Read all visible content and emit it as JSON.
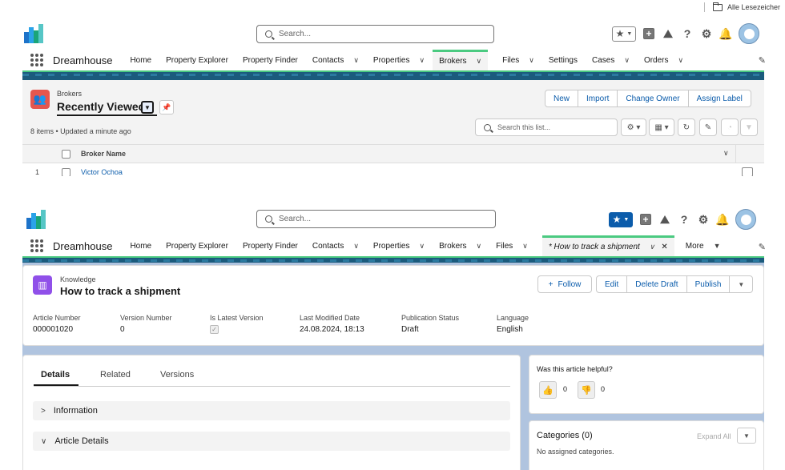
{
  "bookmarks": {
    "label": "Alle Lesezeicher"
  },
  "top": {
    "search_placeholder": "Search...",
    "app_name": "Dreamhouse",
    "nav": [
      "Home",
      "Property Explorer",
      "Property Finder",
      "Contacts",
      "Properties",
      "Brokers",
      "Files",
      "Settings",
      "Cases",
      "Orders"
    ],
    "object_label": "Brokers",
    "list_view": "Recently Viewed",
    "buttons": [
      "New",
      "Import",
      "Change Owner",
      "Assign Label"
    ],
    "status": "8 items • Updated a minute ago",
    "list_search_placeholder": "Search this list...",
    "column_header": "Broker Name",
    "row_num": "1",
    "row_name": "Victor Ochoa"
  },
  "bottom": {
    "search_placeholder": "Search...",
    "app_name": "Dreamhouse",
    "nav": [
      "Home",
      "Property Explorer",
      "Property Finder",
      "Contacts",
      "Properties",
      "Brokers",
      "Files"
    ],
    "tab_label": "* How to track a shipment",
    "more_label": "More",
    "record_type": "Knowledge",
    "record_title": "How to track a shipment",
    "actions": {
      "follow": "Follow",
      "edit": "Edit",
      "delete_draft": "Delete Draft",
      "publish": "Publish"
    },
    "fields": [
      {
        "label": "Article Number",
        "value": "000001020"
      },
      {
        "label": "Version Number",
        "value": "0"
      },
      {
        "label": "Is Latest Version",
        "value": ""
      },
      {
        "label": "Last Modified Date",
        "value": "24.08.2024, 18:13"
      },
      {
        "label": "Publication Status",
        "value": "Draft"
      },
      {
        "label": "Language",
        "value": "English"
      }
    ],
    "tabs": [
      "Details",
      "Related",
      "Versions"
    ],
    "sections": [
      "Information",
      "Article Details"
    ],
    "helpful": {
      "question": "Was this article helpful?",
      "up": "0",
      "down": "0"
    },
    "categories": {
      "title": "Categories (0)",
      "expand": "Expand All",
      "empty": "No assigned categories."
    }
  },
  "colors": {
    "brand_green": "#4bca81",
    "band": "#1b5b7d",
    "link": "#0b5cab",
    "knowledge_icon": "#9050e9",
    "broker_icon": "#e5564e"
  }
}
